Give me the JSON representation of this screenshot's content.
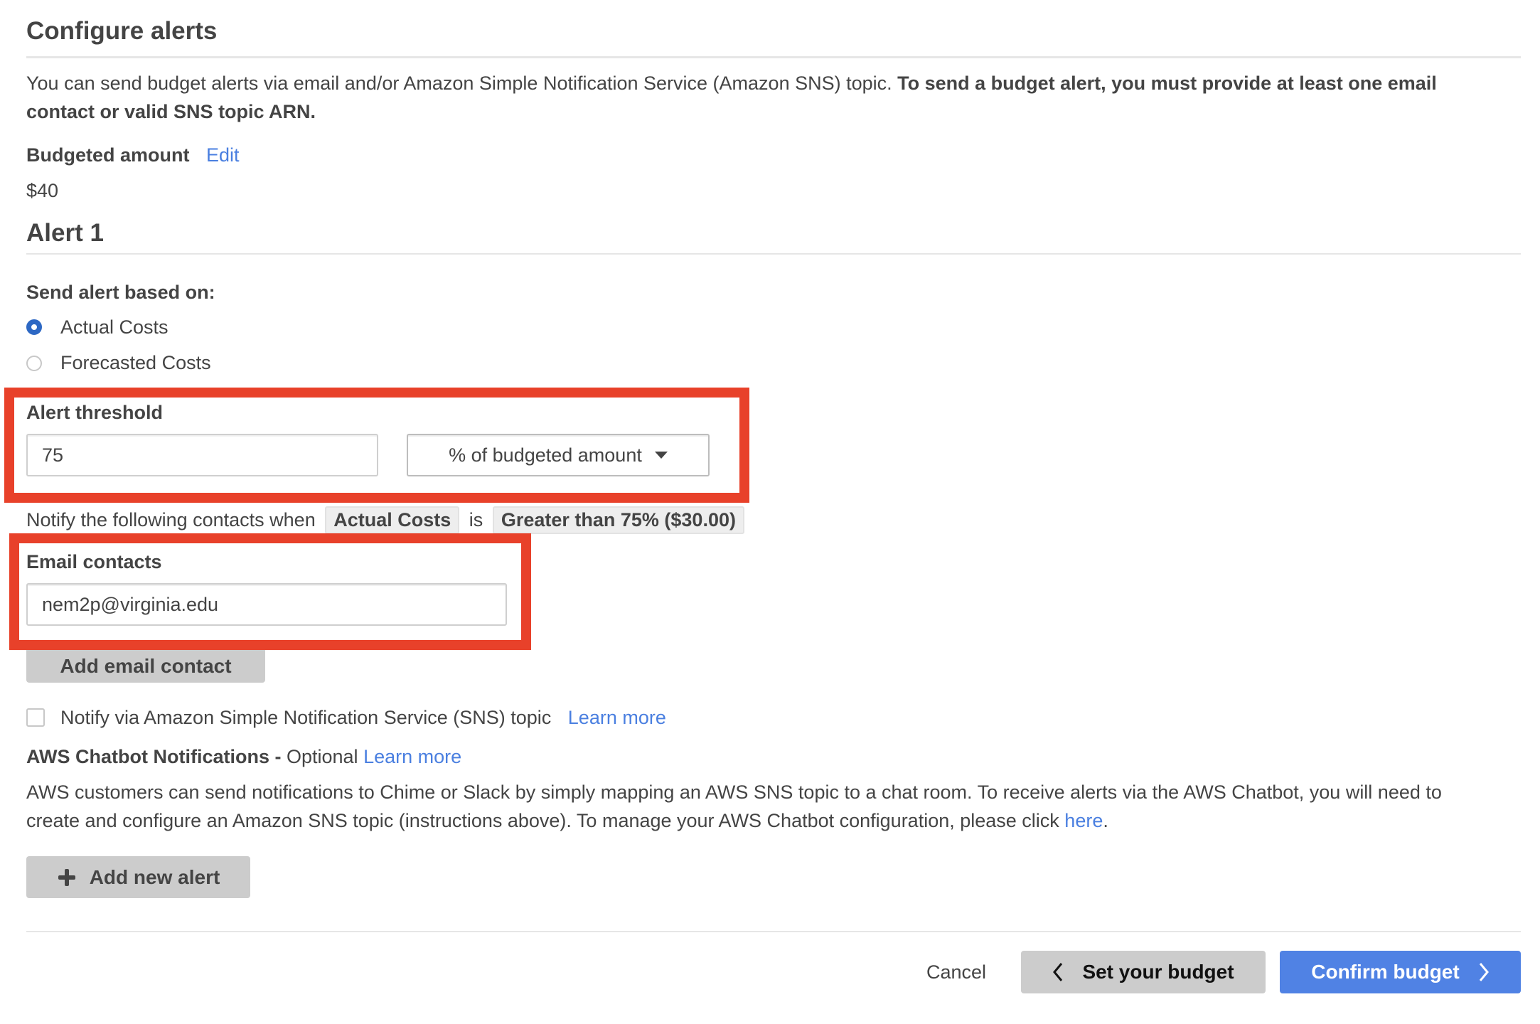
{
  "section": {
    "title": "Configure alerts",
    "intro_regular": "You can send budget alerts via email and/or Amazon Simple Notification Service (Amazon SNS) topic. ",
    "intro_bold_line1": "To send a budget alert, you must provide at least one email",
    "intro_bold_line2": "contact or valid SNS topic ARN."
  },
  "budget": {
    "label": "Budgeted amount",
    "edit_link": "Edit",
    "amount": "$40"
  },
  "alert": {
    "title": "Alert 1",
    "send_based_on_label": "Send alert based on:",
    "options": [
      {
        "label": "Actual Costs",
        "selected": true
      },
      {
        "label": "Forecasted Costs",
        "selected": false
      }
    ],
    "threshold": {
      "label": "Alert threshold",
      "value": "75",
      "unit_selected": "% of budgeted amount"
    },
    "summary": {
      "prefix": "Notify the following contacts when",
      "cost_type": "Actual Costs",
      "connector": "is",
      "condition": "Greater than 75% ($30.00)"
    },
    "email": {
      "label": "Email contacts",
      "value": "nem2p@virginia.edu",
      "add_button": "Add email contact"
    },
    "sns": {
      "checked": false,
      "label": "Notify via Amazon Simple Notification Service (SNS) topic",
      "learn_more": "Learn more"
    },
    "chatbot": {
      "title": "AWS Chatbot Notifications -",
      "optional": " Optional",
      "learn_more": "Learn more",
      "desc_line1": "AWS customers can send notifications to Chime or Slack by simply mapping an AWS SNS topic to a chat room. To receive alerts via the AWS Chatbot, you will need to",
      "desc_line2": "create and configure an Amazon SNS topic (instructions above). To manage your AWS Chatbot configuration, please click ",
      "here_link": "here",
      "desc_end": "."
    }
  },
  "add_alert_button": "Add new alert",
  "footer": {
    "cancel": "Cancel",
    "back": "Set your budget",
    "confirm": "Confirm budget"
  },
  "colors": {
    "accent": "#5082e4",
    "link": "#4a7fe0",
    "radio_selected": "#2d68c4",
    "highlight_box": "#e8412a",
    "secondary_button": "#cccccc"
  }
}
